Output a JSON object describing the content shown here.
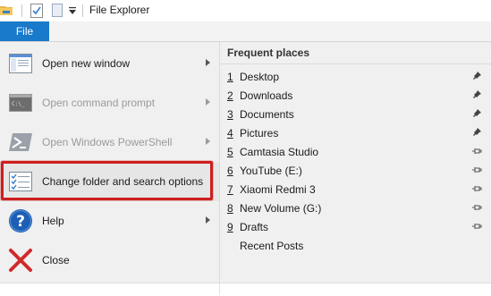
{
  "window": {
    "title": "File Explorer"
  },
  "ribbon": {
    "file_tab_label": "File"
  },
  "menu": {
    "commands": [
      {
        "label": "Open new window",
        "icon": "window-icon",
        "has_submenu": true,
        "enabled": true
      },
      {
        "label": "Open command prompt",
        "icon": "command-prompt-icon",
        "has_submenu": true,
        "enabled": false
      },
      {
        "label": "Open Windows PowerShell",
        "icon": "powershell-icon",
        "has_submenu": true,
        "enabled": false
      },
      {
        "label": "Change folder and search options",
        "icon": "folder-options-icon",
        "has_submenu": false,
        "enabled": true,
        "highlighted": true
      },
      {
        "label": "Help",
        "icon": "help-icon",
        "has_submenu": true,
        "enabled": true
      },
      {
        "label": "Close",
        "icon": "close-icon",
        "has_submenu": false,
        "enabled": true
      }
    ],
    "highlight_color": "#cc1f1f"
  },
  "frequent_places": {
    "header": "Frequent places",
    "items": [
      {
        "num": "1",
        "name": "Desktop",
        "pinned": true
      },
      {
        "num": "2",
        "name": "Downloads",
        "pinned": true
      },
      {
        "num": "3",
        "name": "Documents",
        "pinned": true
      },
      {
        "num": "4",
        "name": "Pictures",
        "pinned": true
      },
      {
        "num": "5",
        "name": "Camtasia Studio",
        "pinned": false
      },
      {
        "num": "6",
        "name": "YouTube (E:)",
        "pinned": false
      },
      {
        "num": "7",
        "name": "Xiaomi Redmi 3",
        "pinned": false
      },
      {
        "num": "8",
        "name": "New Volume (G:)",
        "pinned": false
      },
      {
        "num": "9",
        "name": "Drafts",
        "pinned": false
      },
      {
        "num": "",
        "name": "Recent Posts",
        "pinned": false
      }
    ]
  },
  "colors": {
    "accent": "#1979ca",
    "menu_bg": "#f0f0f0"
  }
}
